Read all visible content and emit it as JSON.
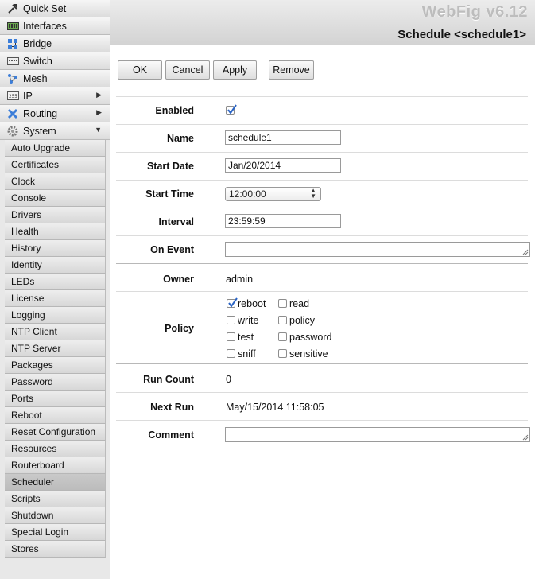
{
  "brand": "WebFig v6.12",
  "page_title": "Schedule <schedule1>",
  "sidebar": {
    "top_items": [
      {
        "label": "Quick Set",
        "icon": "quick-set-icon"
      },
      {
        "label": "Interfaces",
        "icon": "interfaces-icon"
      },
      {
        "label": "Bridge",
        "icon": "bridge-icon"
      },
      {
        "label": "Switch",
        "icon": "switch-icon"
      },
      {
        "label": "Mesh",
        "icon": "mesh-icon"
      },
      {
        "label": "IP",
        "icon": "ip-icon",
        "arrow": "right"
      },
      {
        "label": "Routing",
        "icon": "routing-icon",
        "arrow": "right"
      },
      {
        "label": "System",
        "icon": "system-gear-icon",
        "arrow": "down"
      }
    ],
    "system_items": [
      "Auto Upgrade",
      "Certificates",
      "Clock",
      "Console",
      "Drivers",
      "Health",
      "History",
      "Identity",
      "LEDs",
      "License",
      "Logging",
      "NTP Client",
      "NTP Server",
      "Packages",
      "Password",
      "Ports",
      "Reboot",
      "Reset Configuration",
      "Resources",
      "Routerboard",
      "Scheduler",
      "Scripts",
      "Shutdown",
      "Special Login",
      "Stores"
    ],
    "active_item": "Scheduler"
  },
  "buttons": {
    "ok": "OK",
    "cancel": "Cancel",
    "apply": "Apply",
    "remove": "Remove"
  },
  "form": {
    "enabled": {
      "label": "Enabled",
      "checked": true
    },
    "name": {
      "label": "Name",
      "value": "schedule1"
    },
    "start_date": {
      "label": "Start Date",
      "value": "Jan/20/2014"
    },
    "start_time": {
      "label": "Start Time",
      "value": "12:00:00"
    },
    "interval": {
      "label": "Interval",
      "value": "23:59:59"
    },
    "on_event": {
      "label": "On Event",
      "value": ""
    },
    "owner": {
      "label": "Owner",
      "value": "admin"
    },
    "policy": {
      "label": "Policy",
      "options": [
        {
          "label": "reboot",
          "checked": true
        },
        {
          "label": "read",
          "checked": false
        },
        {
          "label": "write",
          "checked": false
        },
        {
          "label": "policy",
          "checked": false
        },
        {
          "label": "test",
          "checked": false
        },
        {
          "label": "password",
          "checked": false
        },
        {
          "label": "sniff",
          "checked": false
        },
        {
          "label": "sensitive",
          "checked": false
        }
      ]
    },
    "run_count": {
      "label": "Run Count",
      "value": "0"
    },
    "next_run": {
      "label": "Next Run",
      "value": "May/15/2014 11:58:05"
    },
    "comment": {
      "label": "Comment",
      "value": ""
    }
  },
  "colors": {
    "checkmark": "#2a64c5",
    "sidebar_bg": "#e8e8e8",
    "active_item_bg": "#c4c4c4"
  }
}
